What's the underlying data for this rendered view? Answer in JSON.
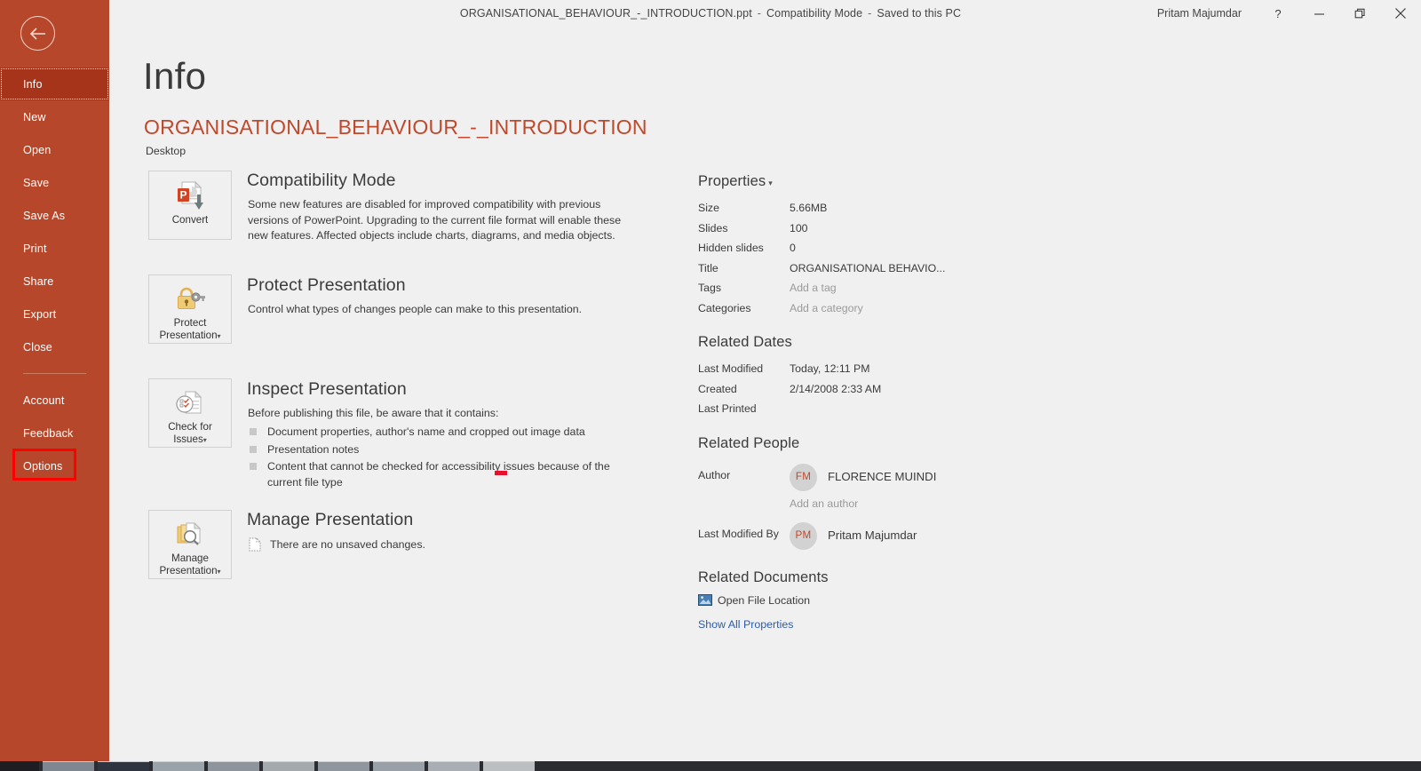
{
  "window": {
    "document_name": "ORGANISATIONAL_BEHAVIOUR_-_INTRODUCTION.ppt",
    "mode": "Compatibility Mode",
    "save_state": "Saved to this PC",
    "separator": "-",
    "user_name": "Pritam Majumdar",
    "help_label": "?",
    "minimize_label": "minimize-icon",
    "restore_label": "restore-icon",
    "close_label": "close-icon"
  },
  "sidebar": {
    "back_label": "back-arrow-icon",
    "items": [
      {
        "label": "Info",
        "selected": true
      },
      {
        "label": "New",
        "selected": false
      },
      {
        "label": "Open",
        "selected": false
      },
      {
        "label": "Save",
        "selected": false
      },
      {
        "label": "Save As",
        "selected": false
      },
      {
        "label": "Print",
        "selected": false
      },
      {
        "label": "Share",
        "selected": false
      },
      {
        "label": "Export",
        "selected": false
      },
      {
        "label": "Close",
        "selected": false
      }
    ],
    "items_lower": [
      {
        "label": "Account",
        "selected": false
      },
      {
        "label": "Feedback",
        "selected": false
      },
      {
        "label": "Options",
        "selected": false,
        "highlighted": true
      }
    ],
    "highlight_color": "#ff0000",
    "background_color": "#b7472a",
    "selected_color": "#a5341a"
  },
  "main": {
    "page_title": "Info",
    "file_title": "ORGANISATIONAL_BEHAVIOUR_-_INTRODUCTION",
    "file_path": "Desktop",
    "file_title_color": "#c0482b",
    "compatibility": {
      "tile_label": "Convert",
      "tile_icon": "convert-powerpoint-icon",
      "heading": "Compatibility Mode",
      "body": "Some new features are disabled for improved compatibility with previous versions of PowerPoint. Upgrading to the current file format will enable these new features. Affected objects include charts, diagrams, and media objects."
    },
    "protect": {
      "tile_label_line1": "Protect",
      "tile_label_line2": "Presentation",
      "tile_icon": "lock-key-icon",
      "heading": "Protect Presentation",
      "body": "Control what types of changes people can make to this presentation."
    },
    "inspect": {
      "tile_label_line1": "Check for",
      "tile_label_line2": "Issues",
      "tile_icon": "document-checklist-icon",
      "heading": "Inspect Presentation",
      "body": "Before publishing this file, be aware that it contains:",
      "bullets": [
        "Document properties, author's name and cropped out image data",
        "Presentation notes",
        "Content that cannot be checked for accessibility issues because of the current file type"
      ]
    },
    "manage": {
      "tile_label_line1": "Manage",
      "tile_label_line2": "Presentation",
      "tile_icon": "document-stack-magnifier-icon",
      "heading": "Manage Presentation",
      "status": "There are no unsaved changes.",
      "status_icon": "unsaved-document-icon"
    },
    "annotation_marker_color": "#e8112d"
  },
  "properties": {
    "heading": "Properties",
    "rows": [
      {
        "key": "Size",
        "value": "5.66MB",
        "placeholder": false
      },
      {
        "key": "Slides",
        "value": "100",
        "placeholder": false
      },
      {
        "key": "Hidden slides",
        "value": "0",
        "placeholder": false
      },
      {
        "key": "Title",
        "value": "ORGANISATIONAL BEHAVIO...",
        "placeholder": false
      },
      {
        "key": "Tags",
        "value": "Add a tag",
        "placeholder": true
      },
      {
        "key": "Categories",
        "value": "Add a category",
        "placeholder": true
      }
    ]
  },
  "related_dates": {
    "heading": "Related Dates",
    "rows": [
      {
        "key": "Last Modified",
        "value": "Today, 12:11 PM"
      },
      {
        "key": "Created",
        "value": "2/14/2008 2:33 AM"
      },
      {
        "key": "Last Printed",
        "value": ""
      }
    ]
  },
  "related_people": {
    "heading": "Related People",
    "author_key": "Author",
    "author_initials": "FM",
    "author_name": "FLORENCE MUINDI",
    "add_author": "Add an author",
    "modified_by_key": "Last Modified By",
    "modified_by_initials": "PM",
    "modified_by_name": "Pritam Majumdar"
  },
  "related_documents": {
    "heading": "Related Documents",
    "open_file_location": "Open File Location",
    "open_file_location_icon": "folder-location-icon",
    "show_all_properties": "Show All Properties",
    "link_color": "#2a5db0"
  }
}
